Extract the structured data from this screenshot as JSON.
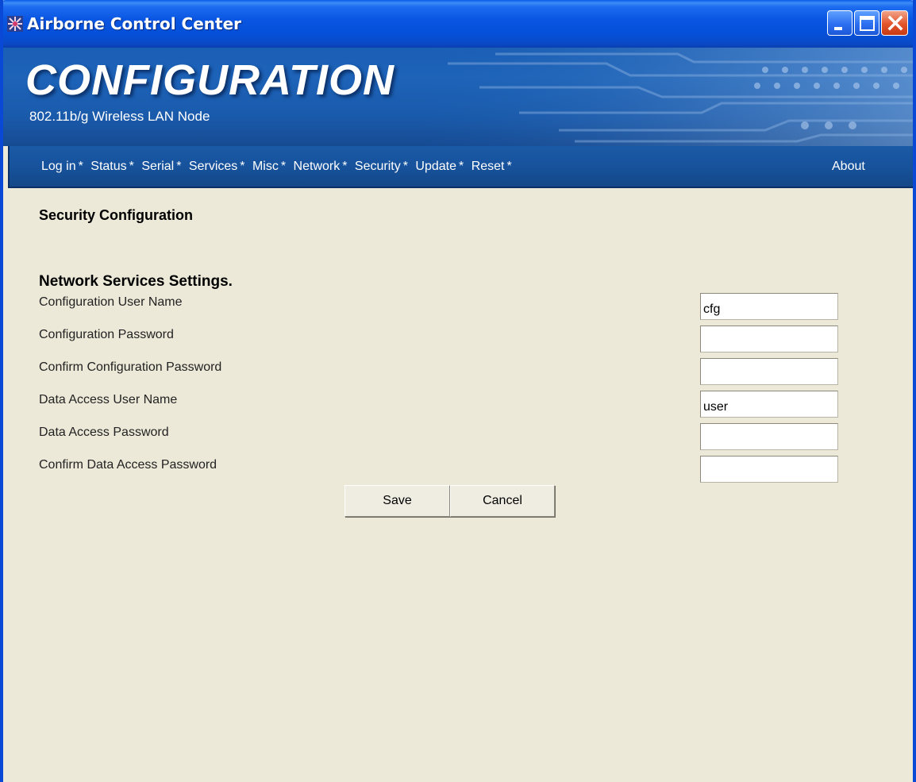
{
  "window": {
    "title": "Airborne Control Center",
    "controls": [
      "minimize-icon",
      "maximize-icon",
      "close-icon"
    ]
  },
  "banner": {
    "title": "CONFIGURATION",
    "subtitle": "802.11b/g Wireless LAN Node"
  },
  "nav": {
    "items": [
      {
        "label": "Log in"
      },
      {
        "label": "Status"
      },
      {
        "label": "Serial"
      },
      {
        "label": "Services"
      },
      {
        "label": "Misc"
      },
      {
        "label": "Network"
      },
      {
        "label": "Security"
      },
      {
        "label": "Update"
      },
      {
        "label": "Reset"
      }
    ],
    "separator": "*",
    "about": "About"
  },
  "page": {
    "title": "Security Configuration",
    "section_title": "Network Services Settings."
  },
  "form": {
    "fields": [
      {
        "label": "Configuration User Name",
        "value": "cfg"
      },
      {
        "label": "Configuration Password",
        "value": ""
      },
      {
        "label": "Confirm Configuration Password",
        "value": ""
      },
      {
        "label": "Data Access User Name",
        "value": "user"
      },
      {
        "label": "Data Access Password",
        "value": ""
      },
      {
        "label": "Confirm Data Access Password",
        "value": ""
      }
    ],
    "save_label": "Save",
    "cancel_label": "Cancel"
  },
  "colors": {
    "titlebar": "#0a56e2",
    "banner": "#1a5fb6",
    "navbar": "#17529c",
    "content_bg": "#ece9d8",
    "close_button": "#e2542a"
  }
}
